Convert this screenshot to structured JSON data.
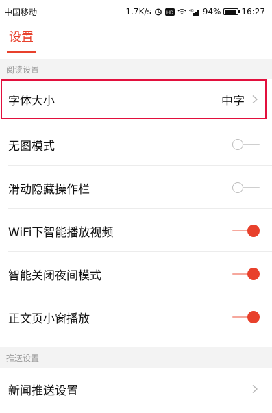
{
  "status_bar": {
    "carrier": "中国移动",
    "speed": "1.7K/s",
    "battery": "94%",
    "time": "16:27",
    "hd_badge": "HD",
    "signal_label": "4G"
  },
  "header": {
    "title": "设置"
  },
  "sections": [
    {
      "title": "阅读设置"
    },
    {
      "title": "推送设置"
    }
  ],
  "rows": {
    "font_size": {
      "label": "字体大小",
      "value": "中字"
    },
    "no_image": {
      "label": "无图模式",
      "on": false
    },
    "hide_toolbar": {
      "label": "滑动隐藏操作栏",
      "on": false
    },
    "wifi_video": {
      "label": "WiFi下智能播放视频",
      "on": true
    },
    "night_mode": {
      "label": "智能关闭夜间模式",
      "on": true
    },
    "small_window": {
      "label": "正文页小窗播放",
      "on": true
    },
    "news_push": {
      "label": "新闻推送设置"
    }
  },
  "colors": {
    "accent": "#e8412c",
    "highlight_border": "#e2103d"
  },
  "icons": [
    "alarm-icon",
    "hd-icon",
    "wifi-icon",
    "signal-icon",
    "battery-icon",
    "chevron-right-icon"
  ]
}
